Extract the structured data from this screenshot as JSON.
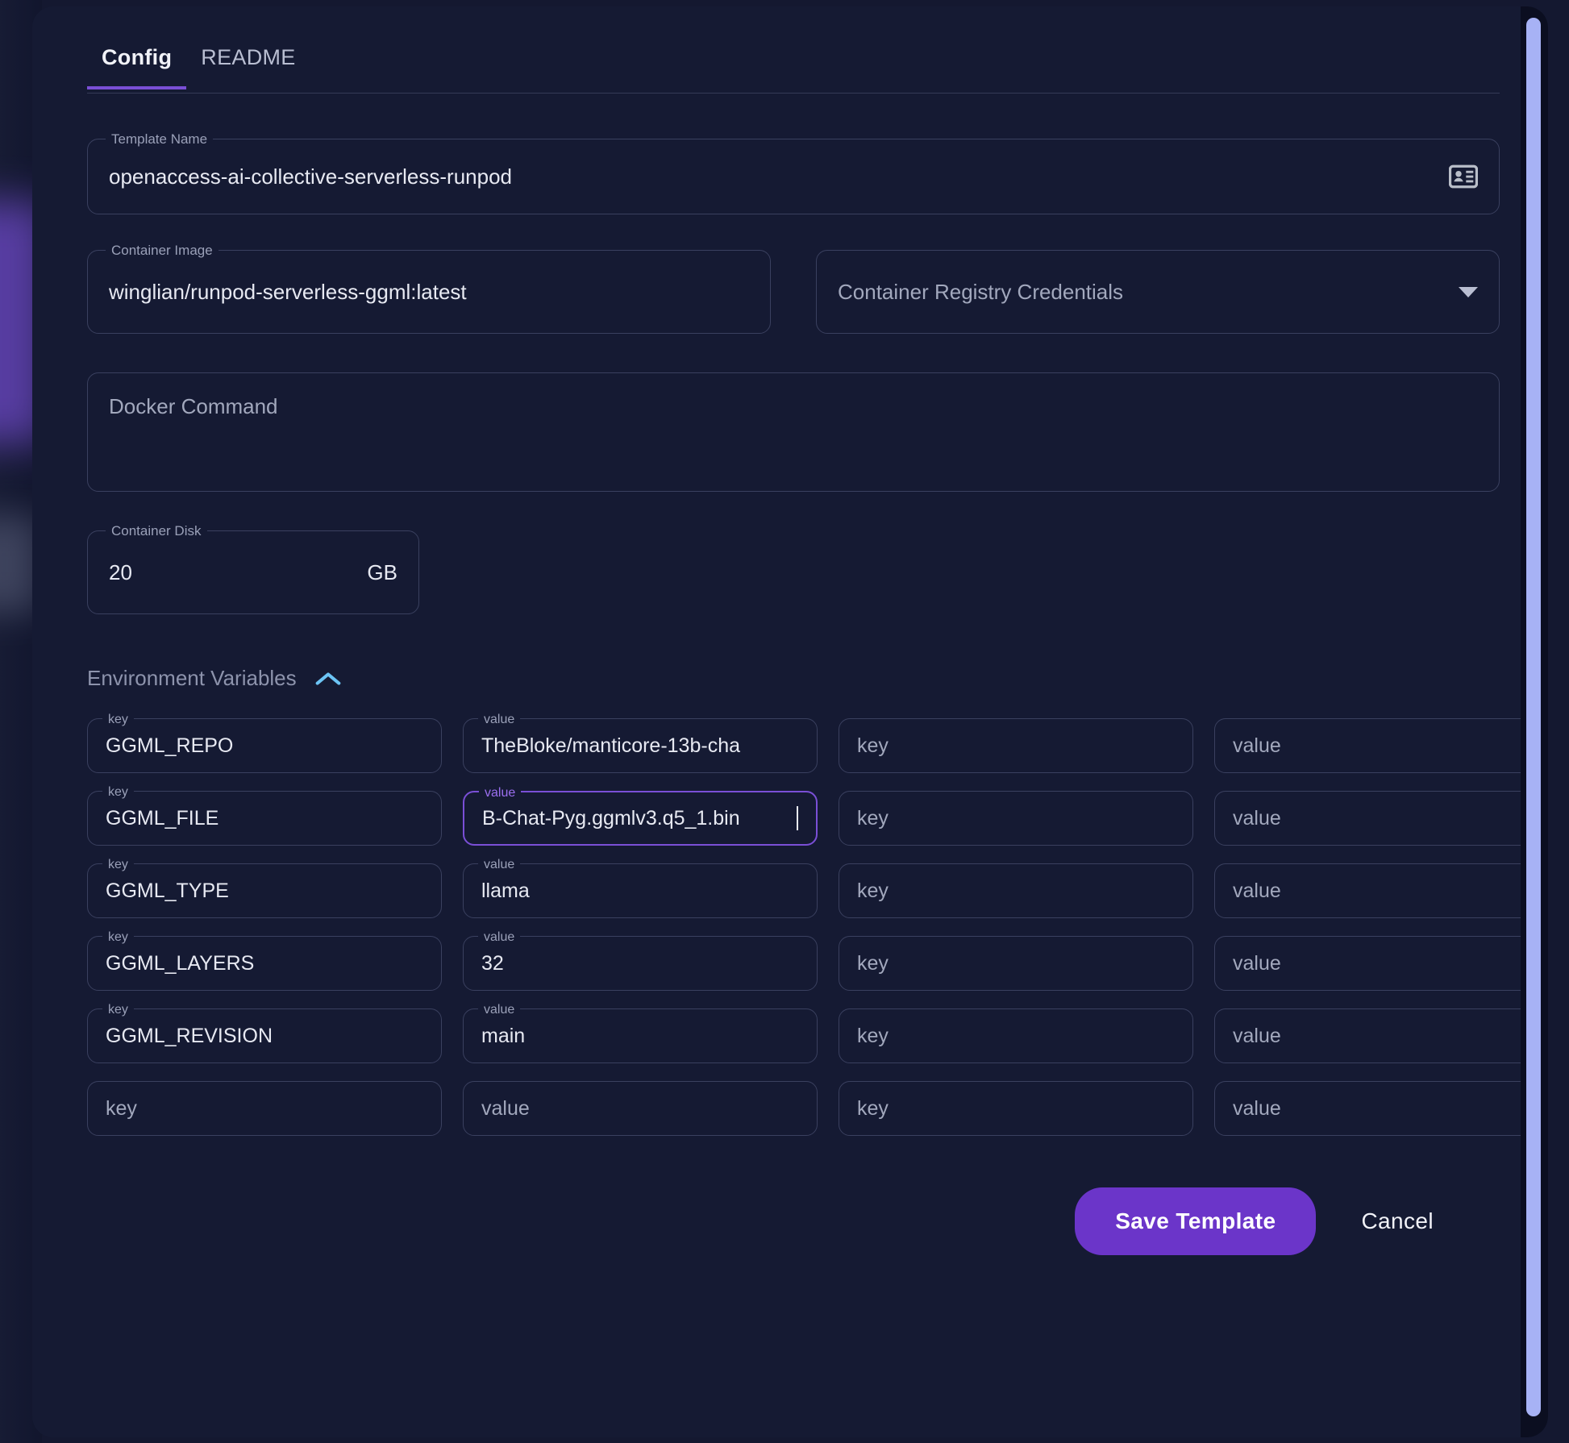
{
  "tabs": [
    {
      "label": "Config",
      "active": true
    },
    {
      "label": "README",
      "active": false
    }
  ],
  "fields": {
    "template_name": {
      "legend": "Template Name",
      "value": "openaccess-ai-collective-serverless-runpod",
      "icon": "contact-card-icon"
    },
    "container_image": {
      "legend": "Container Image",
      "value": "winglian/runpod-serverless-ggml:latest"
    },
    "registry_credentials": {
      "placeholder": "Container Registry Credentials",
      "value": "",
      "icon": "chevron-down-icon"
    },
    "docker_command": {
      "placeholder": "Docker Command",
      "value": ""
    },
    "container_disk": {
      "legend": "Container Disk",
      "value": "20",
      "suffix": "GB"
    }
  },
  "env_section": {
    "title": "Environment Variables",
    "toggle_icon": "chevron-up-icon",
    "key_legend": "key",
    "value_legend": "value",
    "key_placeholder": "key",
    "value_placeholder": "value",
    "rows": [
      {
        "key": "GGML_REPO",
        "value": "TheBloke/manticore-13b-cha",
        "key2": "",
        "value2": "",
        "focused": false
      },
      {
        "key": "GGML_FILE",
        "value": "B-Chat-Pyg.ggmlv3.q5_1.bin",
        "key2": "",
        "value2": "",
        "focused": true
      },
      {
        "key": "GGML_TYPE",
        "value": "llama",
        "key2": "",
        "value2": "",
        "focused": false
      },
      {
        "key": "GGML_LAYERS",
        "value": "32",
        "key2": "",
        "value2": "",
        "focused": false
      },
      {
        "key": "GGML_REVISION",
        "value": "main",
        "key2": "",
        "value2": "",
        "focused": false
      },
      {
        "key": "",
        "value": "",
        "key2": "",
        "value2": "",
        "focused": false
      }
    ]
  },
  "footer": {
    "save_label": "Save Template",
    "cancel_label": "Cancel"
  },
  "colors": {
    "accent_purple": "#6b35c9",
    "focus_purple": "#7a4fd6",
    "tab_underline": "#7a4fd6",
    "chevron_blue": "#6cc4f5",
    "scrollbar_thumb": "#a7b2f5",
    "panel_bg": "#151a33",
    "field_border": "#3a405f"
  }
}
